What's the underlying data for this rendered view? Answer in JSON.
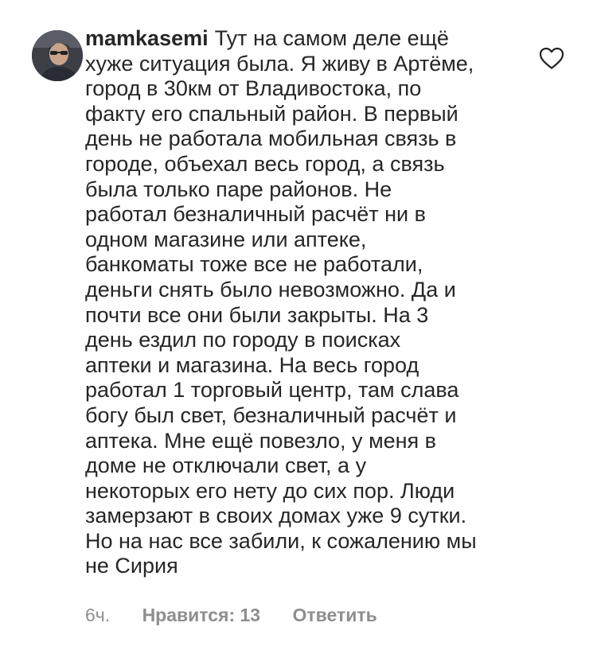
{
  "comment": {
    "username": "mamkasemi",
    "first_line": "Тут на самом деле ещё",
    "lines": [
      "хуже ситуация была. Я живу в Артёме,",
      "город в 30км от Владивостока, по",
      "факту его спальный район. В первый",
      "день не работала мобильная связь в",
      "городе, объехал весь город, а связь",
      "была только паре районов.  Не",
      "работал безналичный расчёт ни в",
      "одном магазине или аптеке,",
      "банкоматы тоже все не работали,",
      "деньги снять было невозможно. Да и",
      "почти все они были закрыты. На 3",
      "день ездил по городу в поисках",
      "аптеки и магазина. На весь город",
      "работал 1 торговый центр, там слава",
      "богу был свет, безналичный расчёт и",
      "аптека. Мне ещё повезло, у меня в",
      "доме не отключали свет, а у",
      "некоторых его нету до сих пор. Люди",
      "замерзают в своих домах уже 9 сутки.",
      "Но на нас все забили, к сожалению мы",
      "не Сирия"
    ],
    "time": "6ч.",
    "likes_label": "Нравится: 13",
    "reply_label": "Ответить"
  },
  "icons": {
    "like": "heart-outline-icon",
    "avatar": "user-avatar"
  },
  "colors": {
    "text": "#262626",
    "secondary": "#8e8e8e"
  }
}
